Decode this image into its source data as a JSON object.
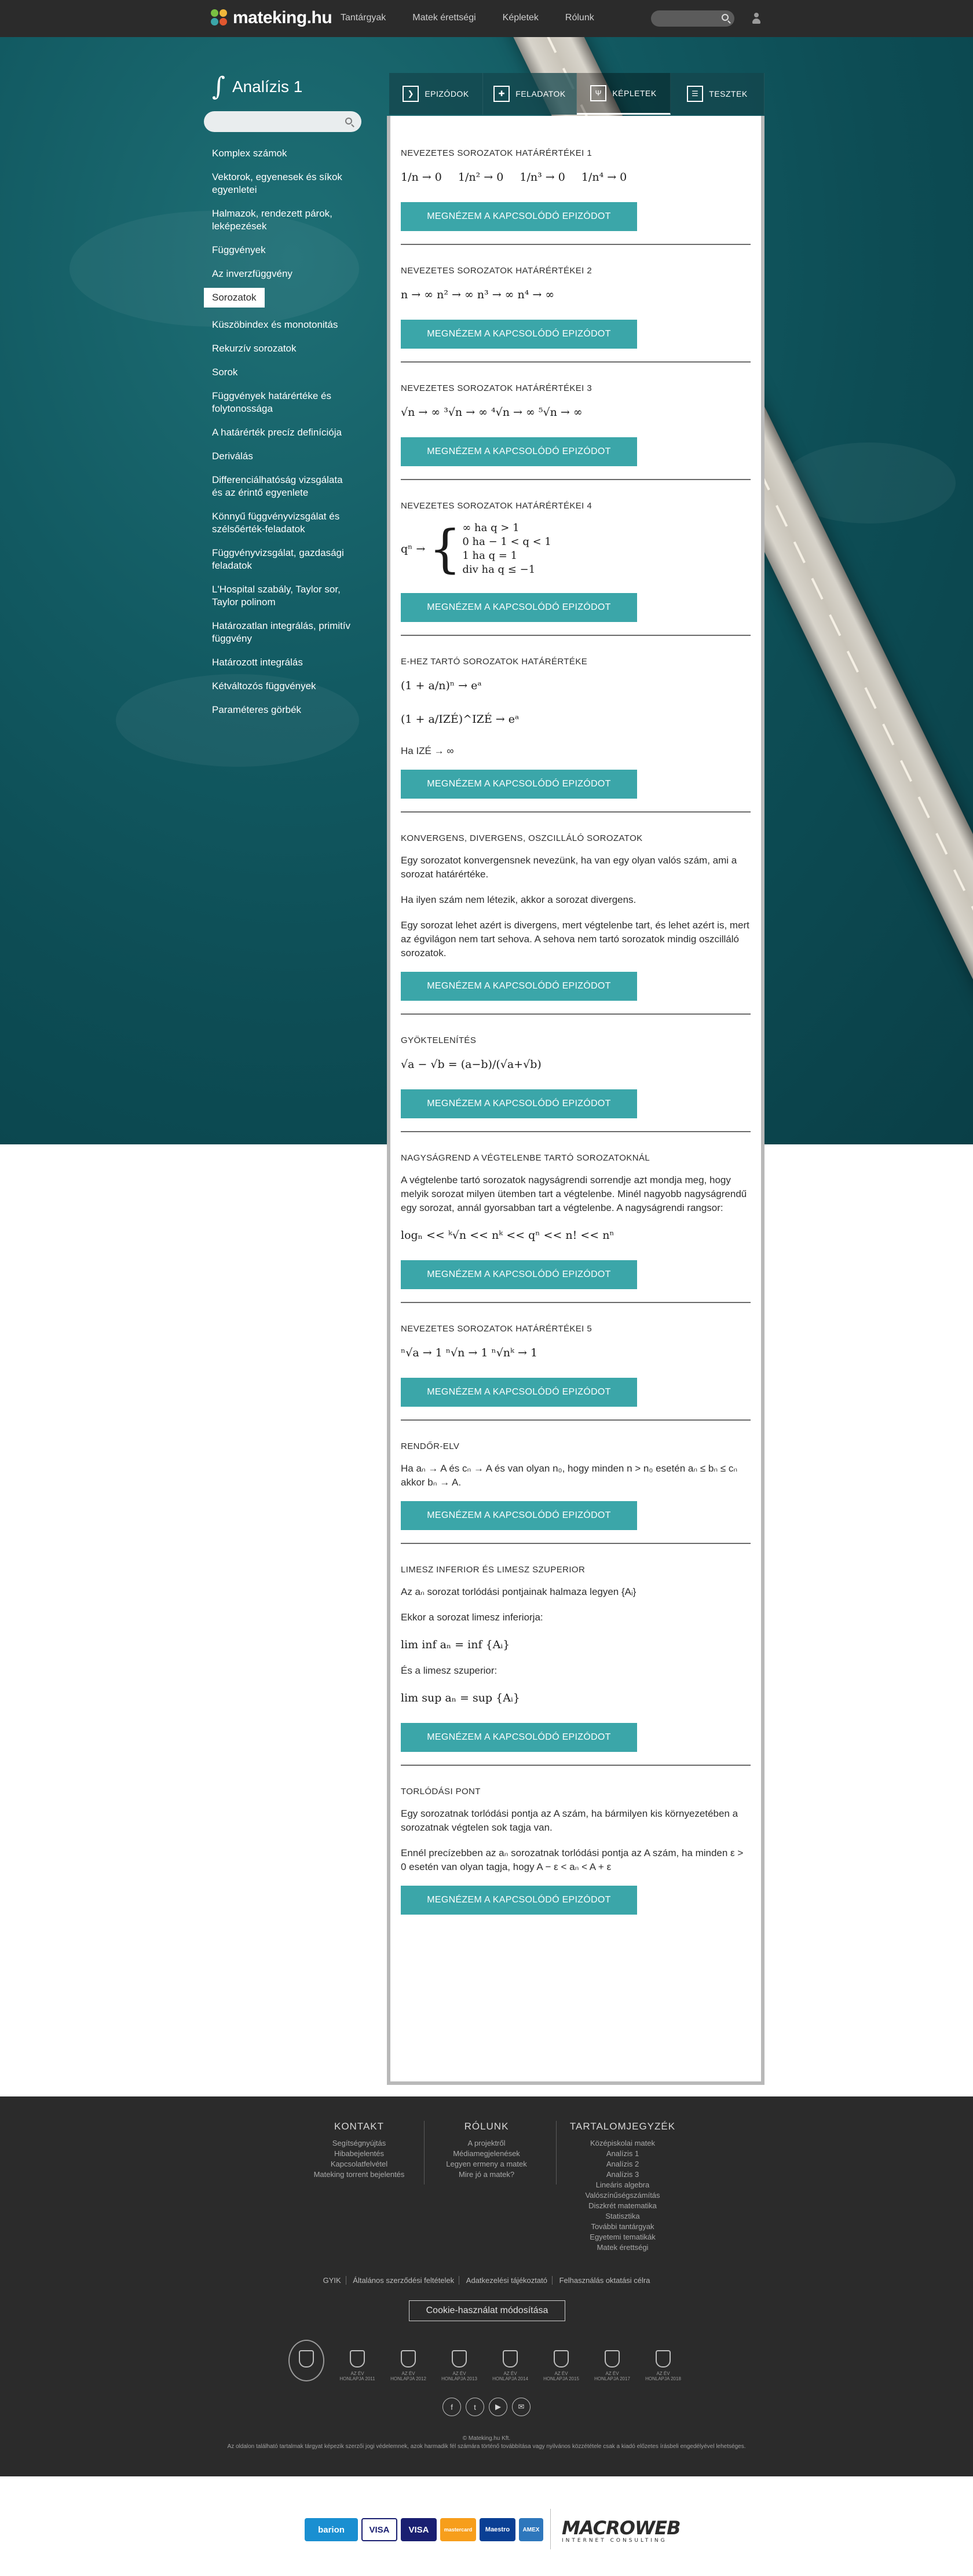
{
  "brand": {
    "name": "mateking.hu",
    "colors": {
      "teal": "#3ba6a9",
      "dark": "#2b2b2b"
    }
  },
  "nav": {
    "links": [
      "Tantárgyak",
      "Matek érettségi",
      "Képletek",
      "Rólunk"
    ],
    "icons": [
      "search-icon",
      "user-icon"
    ]
  },
  "colorstrip": [
    "#7ac142",
    "#3ba6a9",
    "#3ba6a9",
    "#2a8f91",
    "#e08a34",
    "#f0b63a",
    "#d96a30",
    "#e1572f"
  ],
  "sidebar": {
    "title": "Analízis 1",
    "integral_symbol": "∫",
    "items": [
      "Komplex számok",
      "Vektorok, egyenesek és síkok egyenletei",
      "Halmazok, rendezett párok, leképezések",
      "Függvények",
      "Az inverzfüggvény",
      "Sorozatok",
      "Küszöbindex és monotonitás",
      "Rekurzív sorozatok",
      "Sorok",
      "Függvények határértéke és folytonossága",
      "A határérték precíz definíciója",
      "Deriválás",
      "Differenciálhatóság vizsgálata és az érintő egyenlete",
      "Könnyű függvényvizsgálat és szélsőérték-feladatok",
      "Függvényvizsgálat, gazdasági feladatok",
      "L'Hospital szabály, Taylor sor, Taylor polinom",
      "Határozatlan integrálás, primitív függvény",
      "Határozott integrálás",
      "Kétváltozós függvények",
      "Paraméteres görbék"
    ],
    "active_index": 5
  },
  "tabs": [
    {
      "label": "EPIZÓDOK",
      "icon": "play-icon"
    },
    {
      "label": "FELADATOK",
      "icon": "puzzle-icon"
    },
    {
      "label": "KÉPLETEK",
      "icon": "formula-icon"
    },
    {
      "label": "TESZTEK",
      "icon": "checklist-icon"
    }
  ],
  "cta_label": "MEGNÉZEM A KAPCSOLÓDÓ EPIZÓDOT",
  "sections": [
    {
      "title": "Nevezetes sorozatok határértékei 1",
      "formula": [
        "1/n → 0",
        "1/n² → 0",
        "1/n³ → 0",
        "1/n⁴ → 0"
      ]
    },
    {
      "title": "Nevezetes sorozatok határértékei 2",
      "formula": "n → ∞    n² → ∞    n³ → ∞    n⁴ → ∞"
    },
    {
      "title": "Nevezetes sorozatok határértékei 3",
      "formula": "√n → ∞    ³√n → ∞    ⁴√n → ∞    ⁵√n → ∞"
    },
    {
      "title": "Nevezetes sorozatok határértékei 4",
      "lhs": "qⁿ →",
      "cases": [
        "∞ ha q > 1",
        "0 ha  − 1 < q < 1",
        "1 ha q = 1",
        "div ha q ≤ −1"
      ]
    },
    {
      "title": "e-hez tartó sorozatok határértéke",
      "formula1": "(1 + a/n)ⁿ → eᵃ",
      "formula2": "(1 + a/IZÉ)^IZÉ → eᵃ",
      "text": "Ha IZÉ → ∞"
    },
    {
      "title": "Konvergens, divergens, oszcilláló sorozatok",
      "paragraphs": [
        "Egy sorozatot konvergensnek nevezünk, ha van egy olyan valós szám, ami a sorozat határértéke.",
        "Ha ilyen szám nem létezik, akkor a sorozat divergens.",
        "Egy sorozat lehet azért is divergens, mert végtelenbe tart, és lehet azért is, mert az égvilágon nem tart sehova. A sehova nem tartó sorozatok mindig oszcilláló sorozatok."
      ]
    },
    {
      "title": "Gyöktelenítés",
      "formula": "√a − √b = (a−b)/(√a+√b)"
    },
    {
      "title": "Nagyságrend a végtelenbe tartó sorozatoknál",
      "text": "A végtelenbe tartó sorozatok nagyságrendi sorrendje azt mondja meg, hogy melyik sorozat milyen ütemben tart a végtelenbe. Minél nagyobb nagyságrendű egy sorozat, annál gyorsabban tart a végtelenbe. A nagyságrendi rangsor:",
      "formula": "logₙ << ᵏ√n << nᵏ << qⁿ << n! << nⁿ"
    },
    {
      "title": "Nevezetes sorozatok határértékei 5",
      "formula": "ⁿ√a → 1    ⁿ√n → 1    ⁿ√nᵏ → 1"
    },
    {
      "title": "Rendőr-elv",
      "text": "Ha aₙ → A és cₙ → A és van olyan n₀, hogy minden n > n₀ esetén aₙ ≤ bₙ ≤ cₙ akkor bₙ → A."
    },
    {
      "title": "Limesz inferior és limesz szuperior",
      "lines": [
        "Az aₙ sorozat torlódási pontjainak halmaza legyen {Aᵢ}",
        "Ekkor a sorozat limesz inferiorja:",
        "lim inf aₙ = inf {Aᵢ}",
        "És a limesz szuperior:",
        "lim sup aₙ = sup {Aᵢ}"
      ]
    },
    {
      "title": "Torlódási pont",
      "paragraphs": [
        "Egy sorozatnak torlódási pontja az A szám, ha bármilyen kis környezetében a sorozatnak végtelen sok tagja van.",
        "Ennél precízebben az aₙ sorozatnak torlódási pontja az A szám, ha minden ε > 0 esetén van olyan tagja, hogy A − ε < aₙ < A + ε"
      ]
    }
  ],
  "footer": {
    "columns": [
      {
        "title": "KONTAKT",
        "items": [
          "Segítségnyújtás",
          "Hibabejelentés",
          "Kapcsolatfelvétel",
          "Mateking torrent bejelentés"
        ]
      },
      {
        "title": "RÓLUNK",
        "items": [
          "A projektről",
          "Médiamegjelenések",
          "Legyen ermeny a matek",
          "Mire jó a matek?"
        ]
      },
      {
        "title": "TARTALOMJEGYZÉK",
        "items": [
          "Középiskolai matek",
          "Analízis 1",
          "Analízis 2",
          "Analízis 3",
          "Lineáris algebra",
          "Valószínűségszámítás",
          "Diszkrét matematika",
          "Statisztika",
          "További tantárgyak",
          "Egyetemi tematikák",
          "Matek érettségi"
        ]
      }
    ],
    "links": [
      "GYIK",
      "Általános szerződési feltételek",
      "Adatkezelési tájékoztató",
      "Felhasználás oktatási célra"
    ],
    "cookie_button": "Cookie-használat módosítása",
    "badges": [
      "AZ ÉV HONLAPJA 2011",
      "AZ ÉV HONLAPJA 2012",
      "AZ ÉV HONLAPJA 2013",
      "AZ ÉV HONLAPJA 2014",
      "AZ ÉV HONLAPJA 2015",
      "AZ ÉV HONLAPJA 2017",
      "AZ ÉV HONLAPJA 2018",
      "AZ ÉV HONLAPJA 2019"
    ],
    "social": [
      "facebook-icon",
      "twitter-icon",
      "youtube-icon",
      "mail-icon"
    ],
    "copyright": "© Mateking.hu Kft.",
    "legal": "Az oldalon található tartalmak tárgyat képezik szerzői jogi védelemnek, azok harmadik fél számára történő továbbítása vagy nyilvános közzététele csak a kiadó előzetes írásbeli engedélyével lehetséges."
  },
  "payment": {
    "cards": [
      "barion",
      "VISA",
      "VISA",
      "mastercard",
      "Maestro",
      "AMEX"
    ],
    "partner": "MACROWEB",
    "partner_sub": "INTERNET CONSULTING"
  }
}
